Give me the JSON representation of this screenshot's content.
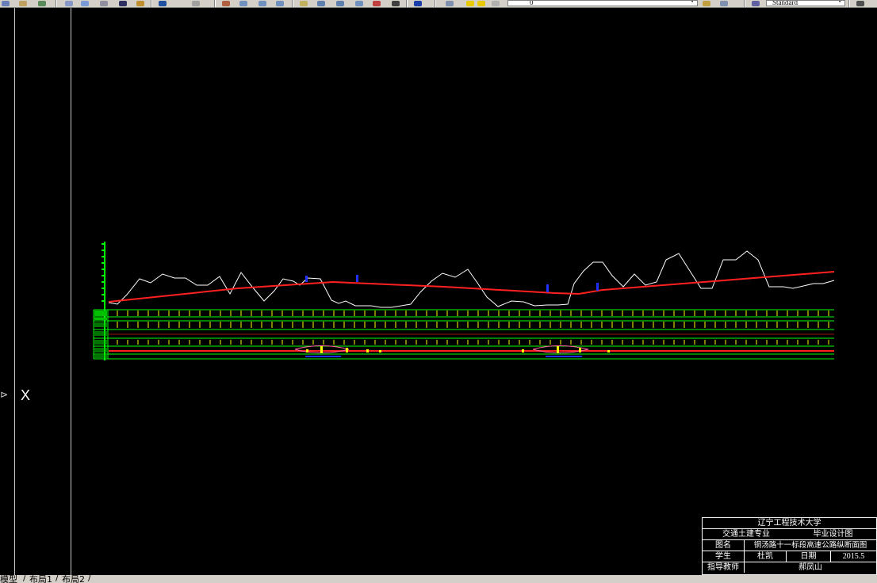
{
  "toolbar": {
    "layer_value": "0",
    "textstyle_value": "Standard",
    "colors": {
      "face": "#d4d0c8",
      "blue": "#1a3fa8",
      "yellow": "#e8c800",
      "red": "#c02020"
    }
  },
  "canvas": {
    "background": "#000000",
    "profile": {
      "ground_color": "#ffffff",
      "design_color": "#ff2020",
      "axis_color": "#00ff00",
      "band_color": "#ffff00",
      "marker_color": "#2030ff"
    }
  },
  "tabs": {
    "model": "模型",
    "layout1": "布局1",
    "layout2": "布局2"
  },
  "title_block": {
    "university": "辽宁工程技术大学",
    "major": "交通土建专业",
    "drawing_type": "毕业设计图",
    "drawing_name_label": "图名",
    "drawing_name": "铜汤路十一标段高速公路纵断面图",
    "student_label": "学生",
    "student": "杜凯",
    "date_label": "日期",
    "date": "2015.5",
    "advisor_label": "指导教师",
    "advisor": "郝凤山"
  }
}
